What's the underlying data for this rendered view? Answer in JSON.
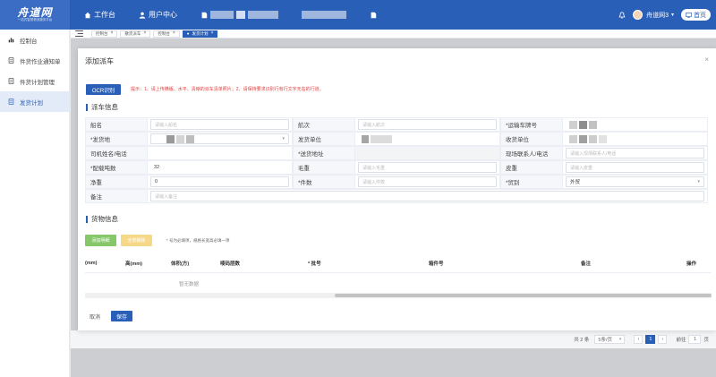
{
  "app": {
    "logo_main": "舟道网",
    "logo_sub": "一站式智慧物流服务平台"
  },
  "topnav": {
    "workbench": "工作台",
    "user_center": "用户中心",
    "username": "舟道网3",
    "home": "首页"
  },
  "sidebar": {
    "items": [
      {
        "label": "控制台",
        "icon": "bar-chart-icon"
      },
      {
        "label": "件货作业通知单",
        "icon": "document-icon"
      },
      {
        "label": "件货计划管理",
        "icon": "document-icon"
      },
      {
        "label": "发货计划",
        "icon": "document-icon"
      }
    ]
  },
  "tabs": [
    {
      "label": "控制台"
    },
    {
      "label": "散货派车"
    },
    {
      "label": "控制台"
    },
    {
      "label": "发货计划"
    }
  ],
  "dialog": {
    "title": "添加派车",
    "ocr_button": "OCR识别",
    "ocr_tip": "提示：1、请上传横版、水平、清晰的派车清单照片；2、请保持要求识别行有行文字无右的行道。",
    "section_dispatch": "派车信息",
    "section_goods": "货物信息",
    "form": {
      "row1": {
        "l1": "船名",
        "p1": "请输入船名",
        "l2": "航次",
        "p2": "请输入航次",
        "l3": "*运输车牌号"
      },
      "row2": {
        "l1": "*发货地",
        "l2": "发货单位",
        "l3": "收货单位"
      },
      "row3": {
        "l1": "司机姓名/电话",
        "l2": "*送货地址",
        "l3": "现场联系人/电话",
        "p3": "请输入现场联系人/电话"
      },
      "row4": {
        "l1": "*配载吨数",
        "v1": "32",
        "l2": "毛重",
        "p2": "请输入毛重",
        "l3": "皮重",
        "p3": "请输入皮重"
      },
      "row5": {
        "l1": "净重",
        "v1": "0",
        "l2": "*件数",
        "p2": "请输入件数",
        "l3": "*贸别",
        "v3": "外贸"
      },
      "row6": {
        "l1": "备注",
        "p1": "请输入备注"
      }
    },
    "goods": {
      "add_detail": "添加明细",
      "delete_all": "全部删除",
      "tip": "* 号为必填项，规格长宽高必填一项",
      "columns": [
        "(mm)",
        "高(mm)",
        "体积(方)",
        "唛码层数",
        "* 批号",
        "箱件号",
        "备注",
        "操作"
      ],
      "empty": "暂无数据"
    },
    "cancel": "取消",
    "save": "保存"
  },
  "pager": {
    "total": "共 2 条",
    "size": "5条/页",
    "current": "1",
    "goto": "前往",
    "goto_value": "1",
    "page_unit": "页"
  },
  "colors": {
    "primary": "#2a5fb8",
    "green": "#86c76a",
    "yellow": "#f6d889",
    "tip_red": "#e43d3d"
  }
}
